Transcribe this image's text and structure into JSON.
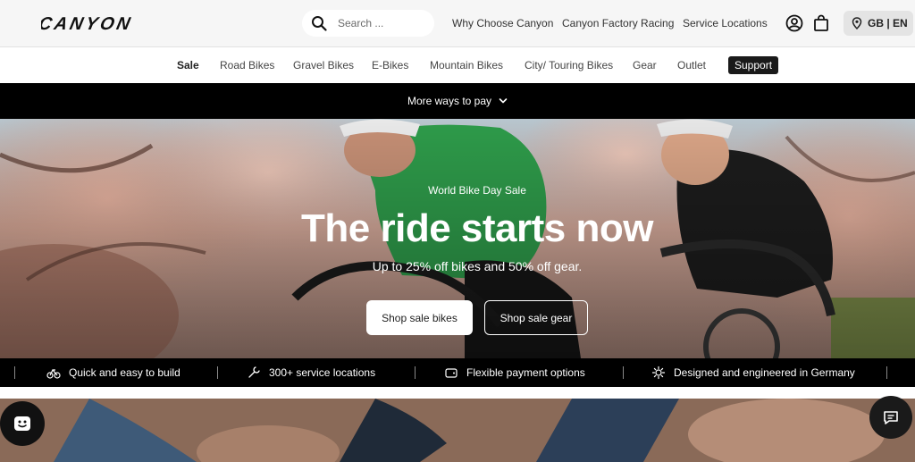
{
  "header": {
    "logo_text": "CANYON",
    "search_placeholder": "Search ...",
    "links": [
      "Why Choose Canyon",
      "Canyon Factory Racing",
      "Service Locations"
    ],
    "locale_label": "GB | EN"
  },
  "nav": {
    "items": [
      "Sale",
      "Road Bikes",
      "Gravel Bikes",
      "E-Bikes",
      "Mountain Bikes",
      "City/ Touring Bikes",
      "Gear",
      "Outlet",
      "Support"
    ]
  },
  "paybar": {
    "label": "More ways to pay"
  },
  "hero": {
    "eyebrow": "World Bike Day Sale",
    "title": "The ride starts now",
    "subtitle": "Up to 25% off bikes and 50% off gear.",
    "primary_button": "Shop sale bikes",
    "secondary_button": "Shop sale gear"
  },
  "usps": [
    {
      "label": "Quick and easy to build",
      "icon": "bike-build-icon"
    },
    {
      "label": "300+ service locations",
      "icon": "service-tool-icon"
    },
    {
      "label": "Flexible payment options",
      "icon": "wallet-icon"
    },
    {
      "label": "Designed and engineered in Germany",
      "icon": "gear-badge-icon"
    }
  ],
  "colors": {
    "dark": "#000000",
    "header_bg": "#f6f6f6",
    "accent_support": "#1a1a1a",
    "hero_text": "#ffffff"
  }
}
